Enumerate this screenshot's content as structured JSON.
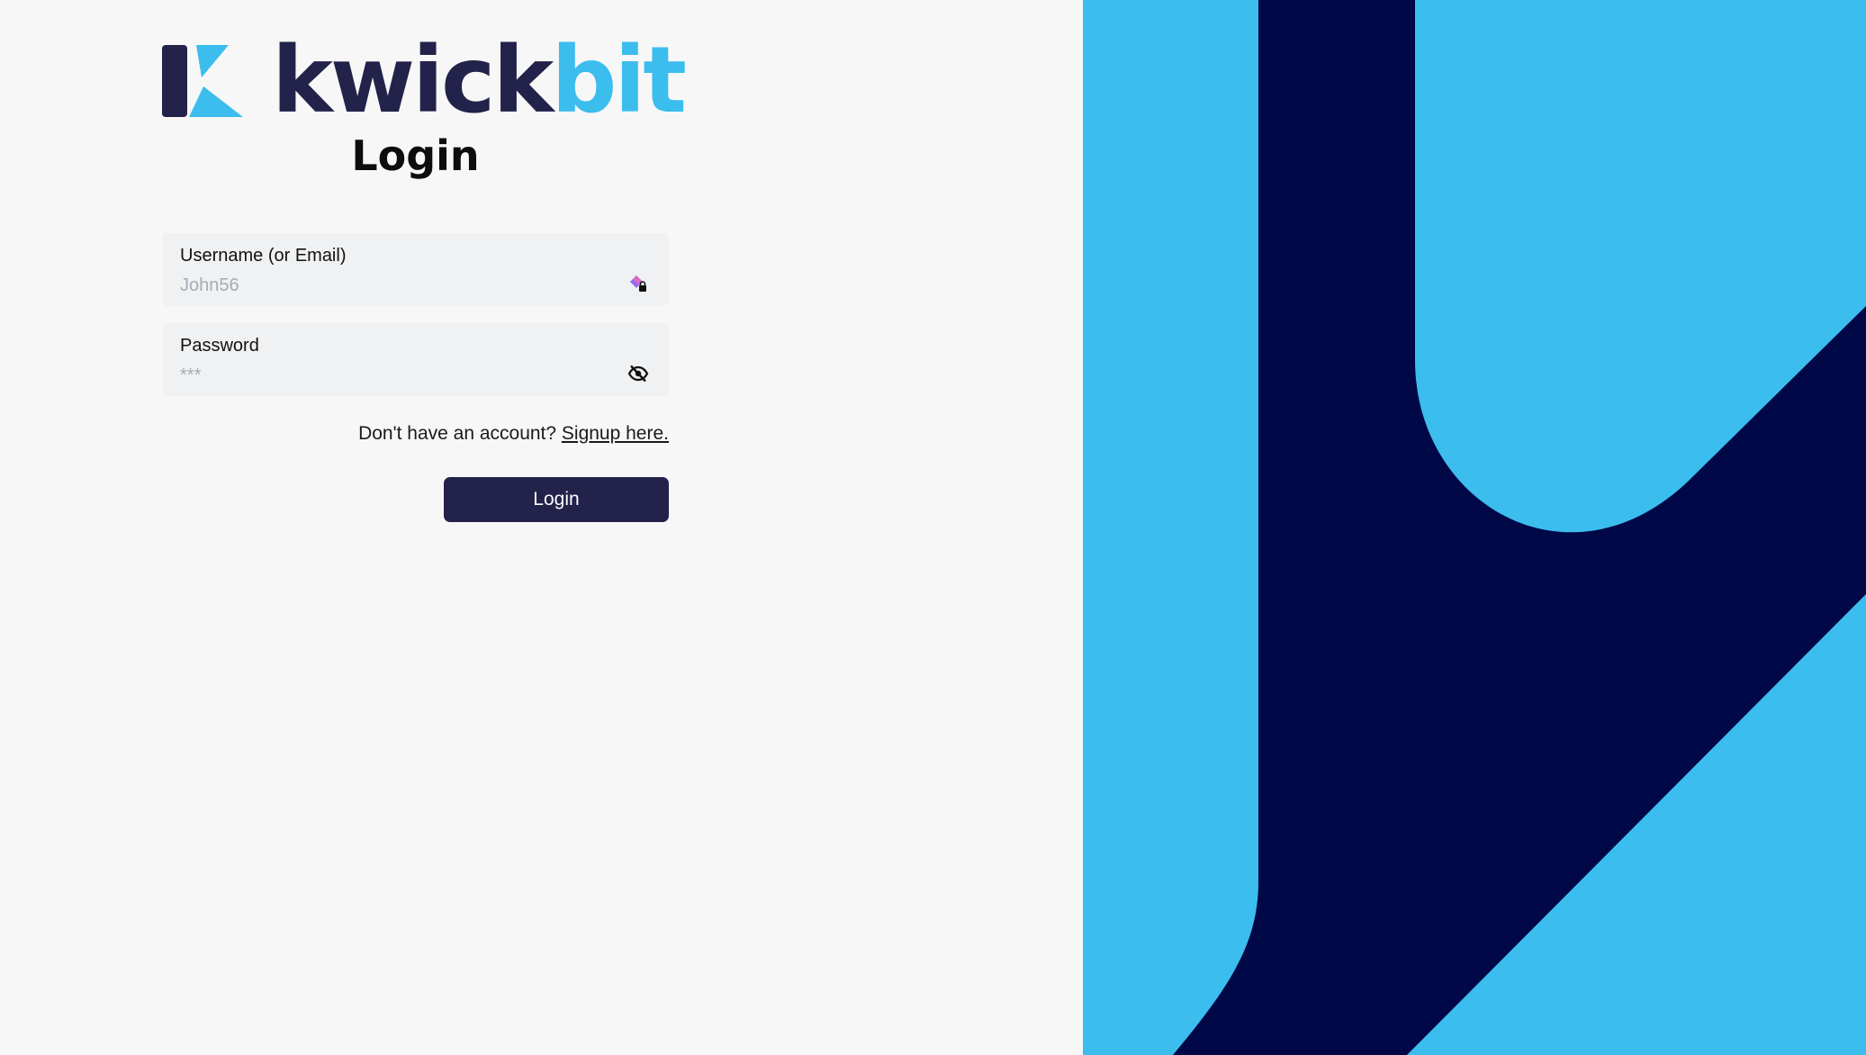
{
  "brand": {
    "name_part1": "kwick",
    "name_part2": "bit",
    "logo_icon": "kwickbit-k-logo",
    "color_dark": "#22224a",
    "color_light": "#3bbdee"
  },
  "page": {
    "title": "Login"
  },
  "form": {
    "username": {
      "label": "Username (or Email)",
      "value": "",
      "placeholder": "John56",
      "icon": "password-manager-icon"
    },
    "password": {
      "label": "Password",
      "value": "",
      "placeholder": "***",
      "icon": "eye-slash-icon"
    },
    "signup_prompt": "Don't have an account?",
    "signup_link": "Signup here.",
    "submit_label": "Login"
  },
  "decor": {
    "panel_light": "#3bbdee",
    "panel_dark": "#000848"
  }
}
